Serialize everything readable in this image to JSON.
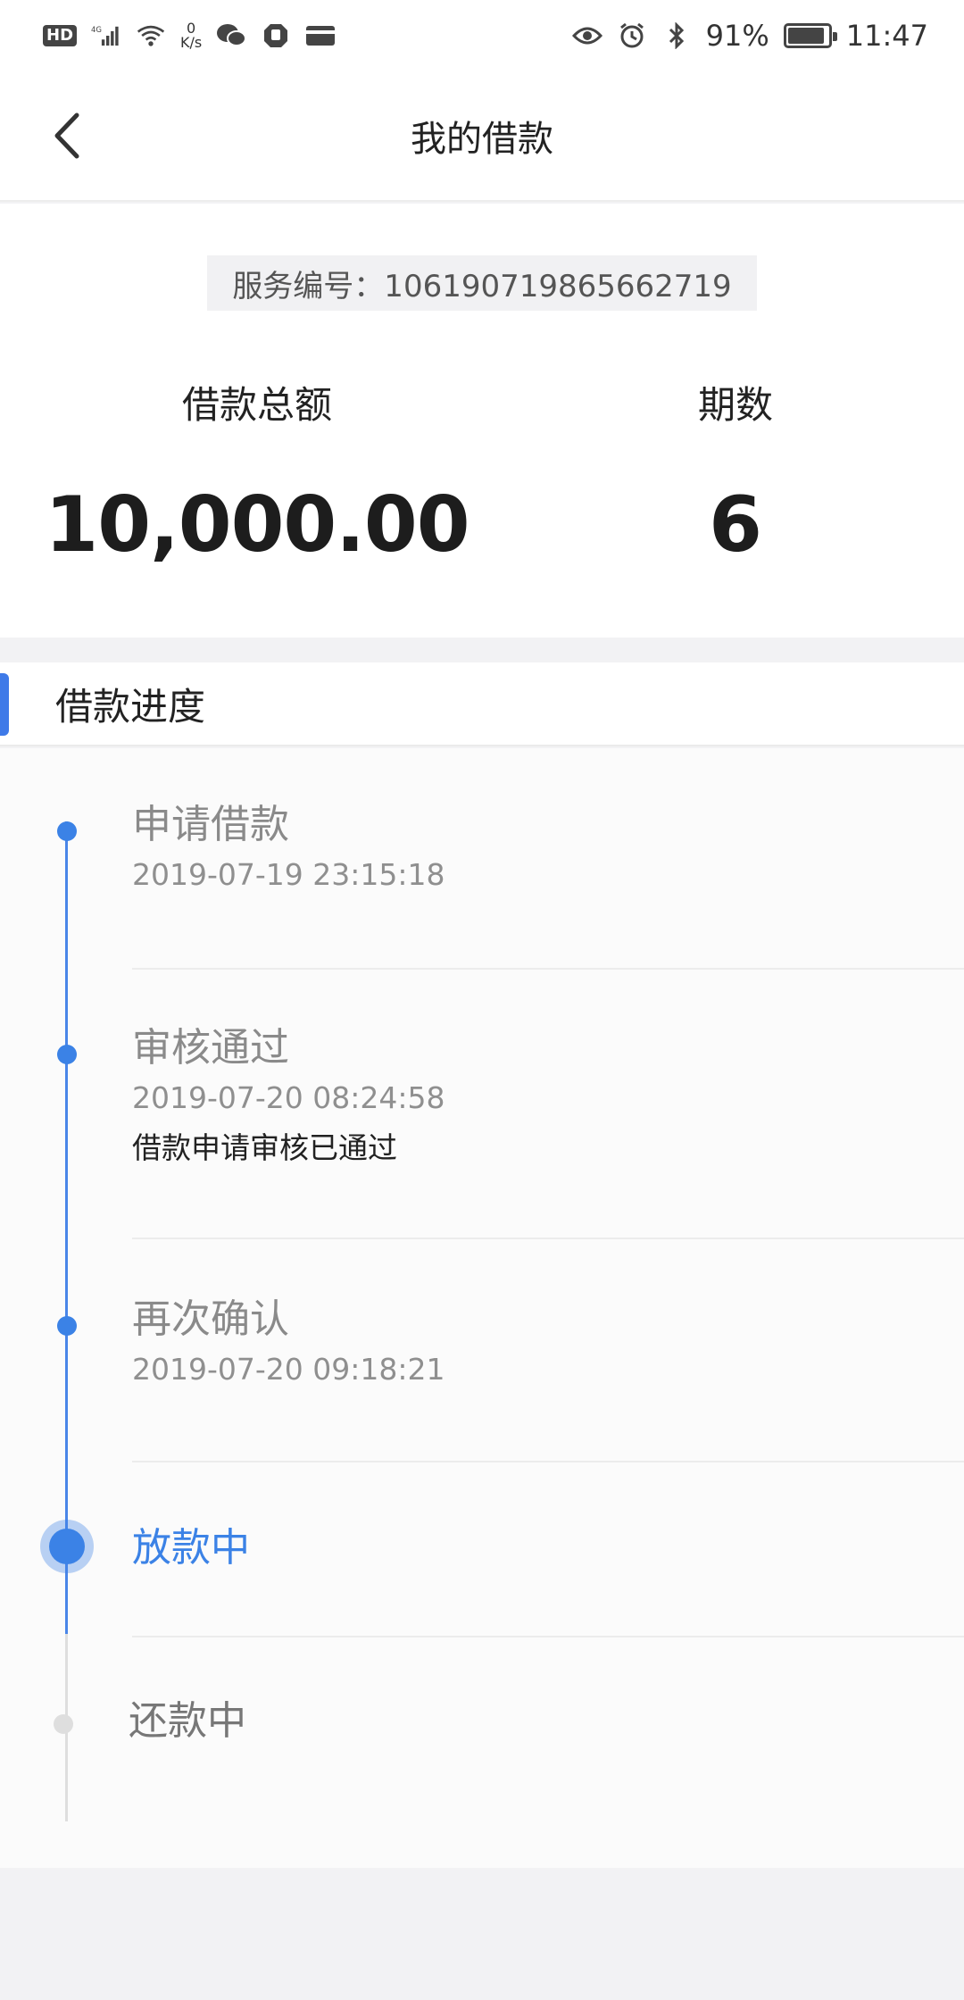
{
  "status_bar": {
    "hd": "HD",
    "network": "4G",
    "speed_value": "0",
    "speed_unit": "K/s",
    "battery_percent": "91%",
    "battery_level": 0.91,
    "time": "11:47",
    "icons": [
      "hd-icon",
      "signal-icon",
      "wifi-icon",
      "wechat-icon",
      "hand-icon",
      "card-icon",
      "eye-icon",
      "alarm-icon",
      "bluetooth-icon",
      "battery-icon"
    ]
  },
  "header": {
    "title": "我的借款",
    "back_icon": "chevron-left-icon"
  },
  "summary": {
    "service_number": "服务编号：106190719865662719",
    "amount_label": "借款总额",
    "amount_value": "10,000.00",
    "term_label": "期数",
    "term_value": "6"
  },
  "progress": {
    "title": "借款进度",
    "accent_color": "#3e7ae8",
    "steps": [
      {
        "title": "申请借款",
        "time": "2019-07-19 23:15:18",
        "note": "",
        "status": "done"
      },
      {
        "title": "审核通过",
        "time": "2019-07-20 08:24:58",
        "note": "借款申请审核已通过",
        "status": "done"
      },
      {
        "title": "再次确认",
        "time": "2019-07-20 09:18:21",
        "note": "",
        "status": "done"
      },
      {
        "title": "放款中",
        "time": "",
        "note": "",
        "status": "current"
      },
      {
        "title": "还款中",
        "time": "",
        "note": "",
        "status": "pending"
      }
    ]
  }
}
